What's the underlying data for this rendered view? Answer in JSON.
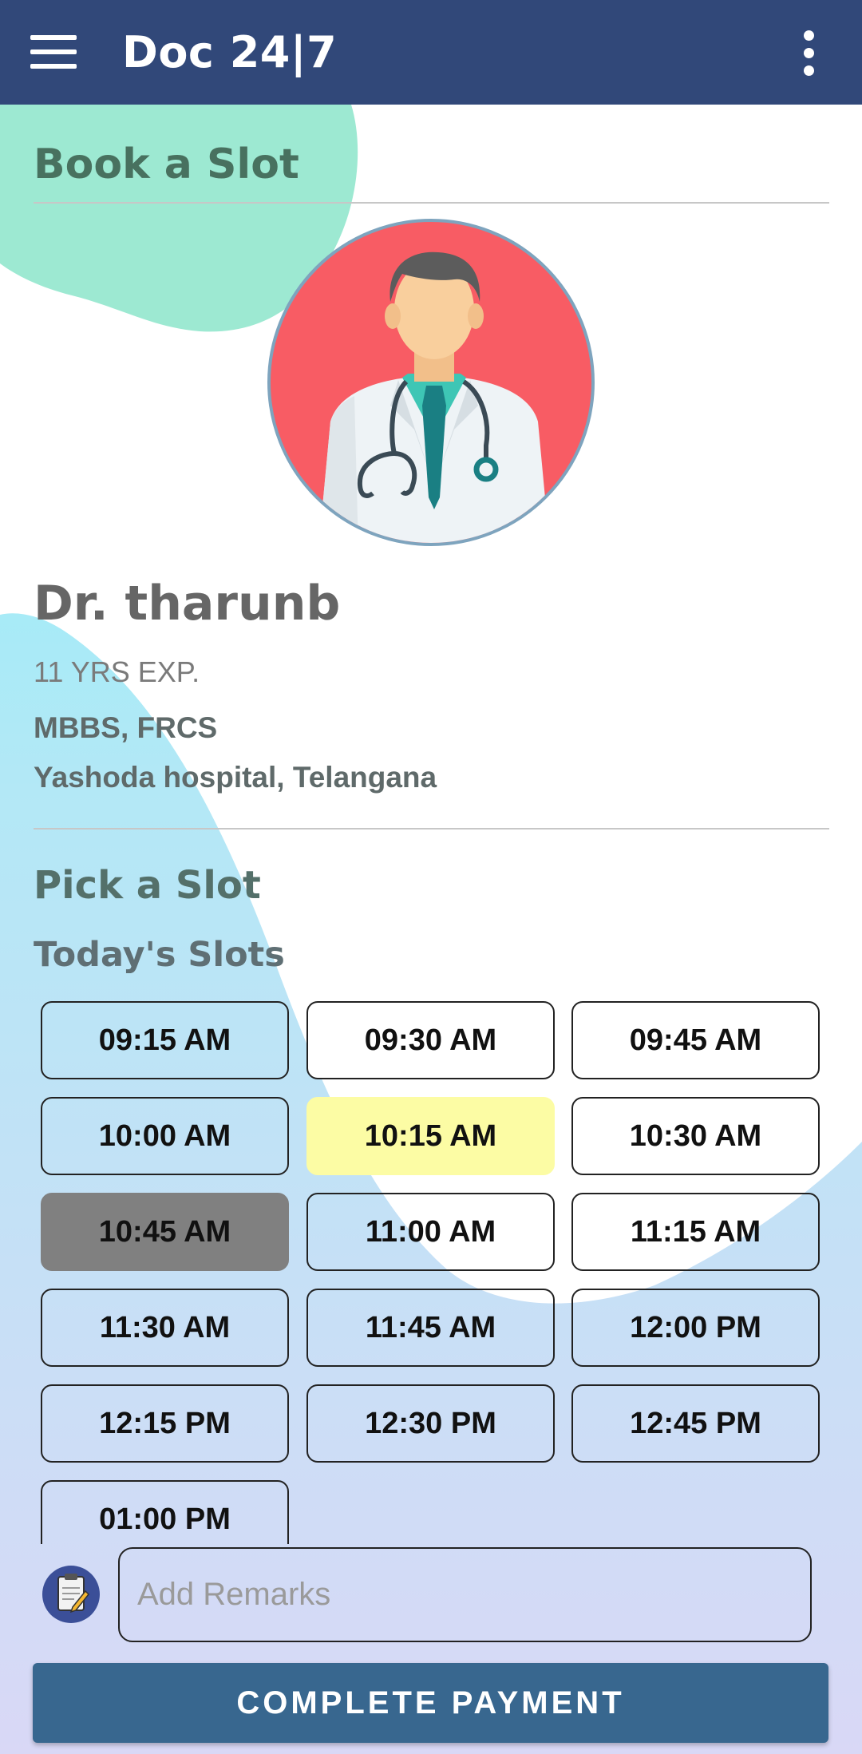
{
  "app_bar": {
    "title": "Doc 24|7",
    "menu_icon": "hamburger-menu-icon",
    "more_icon": "more-vert-icon"
  },
  "booking": {
    "section_title": "Book a Slot"
  },
  "doctor": {
    "name": "Dr. tharunb",
    "experience": "11 YRS EXP.",
    "qualifications": "MBBS, FRCS",
    "hospital": "Yashoda hospital, Telangana",
    "avatar_icon": "doctor-avatar-icon"
  },
  "slots_section": {
    "title": "Pick a Slot",
    "subtitle": "Today's Slots",
    "slots": [
      {
        "time": "09:15 AM",
        "state": "available"
      },
      {
        "time": "09:30 AM",
        "state": "available"
      },
      {
        "time": "09:45 AM",
        "state": "available"
      },
      {
        "time": "10:00 AM",
        "state": "available"
      },
      {
        "time": "10:15 AM",
        "state": "selected"
      },
      {
        "time": "10:30 AM",
        "state": "available"
      },
      {
        "time": "10:45 AM",
        "state": "unavailable"
      },
      {
        "time": "11:00 AM",
        "state": "available"
      },
      {
        "time": "11:15 AM",
        "state": "available"
      },
      {
        "time": "11:30 AM",
        "state": "available"
      },
      {
        "time": "11:45 AM",
        "state": "available"
      },
      {
        "time": "12:00 PM",
        "state": "available"
      },
      {
        "time": "12:15 PM",
        "state": "available"
      },
      {
        "time": "12:30 PM",
        "state": "available"
      },
      {
        "time": "12:45 PM",
        "state": "available"
      },
      {
        "time": "01:00 PM",
        "state": "available"
      }
    ]
  },
  "remarks": {
    "placeholder": "Add Remarks",
    "value": "",
    "icon": "clipboard-icon"
  },
  "payment": {
    "button_label": "COMPLETE PAYMENT"
  },
  "colors": {
    "app_bar": "#314879",
    "payment_button": "#38678f",
    "selected_slot": "#fcfca4",
    "unavailable_slot": "#808080",
    "avatar_bg": "#f85c64"
  }
}
